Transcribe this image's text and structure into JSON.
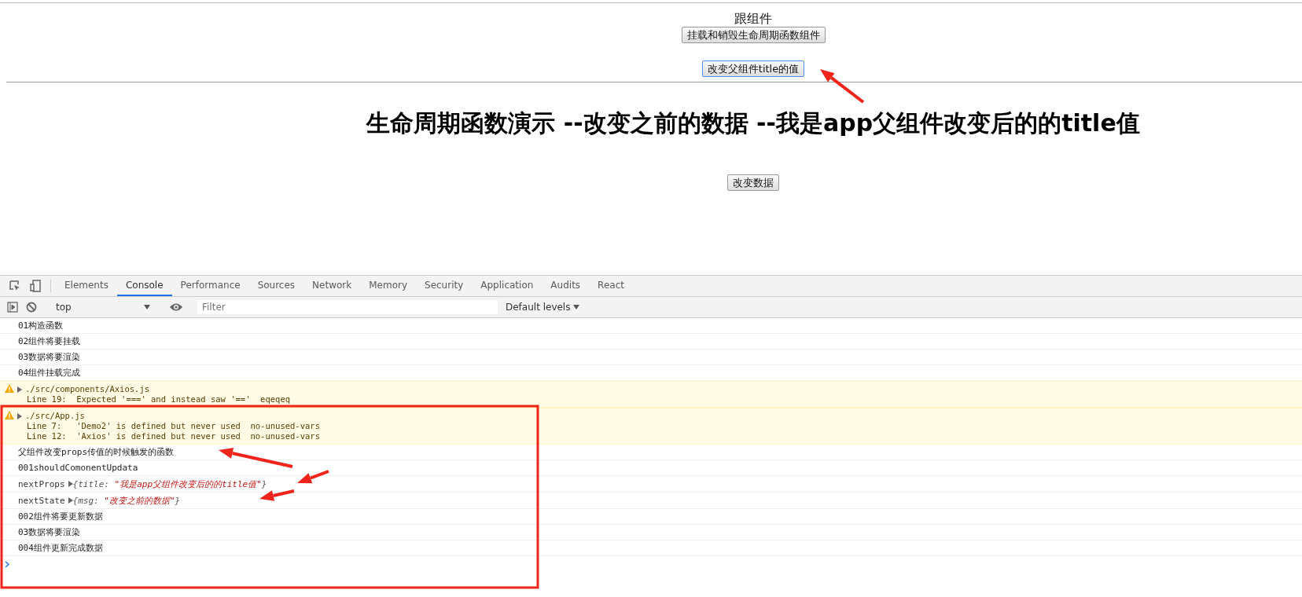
{
  "page": {
    "title": "跟组件",
    "mount_button": "挂载和销毁生命周期函数组件",
    "change_title_button": "改变父组件title的值",
    "heading": "生命周期函数演示 --改变之前的数据 --我是app父组件改变后的的title值",
    "change_data_button": "改变数据"
  },
  "devtools": {
    "tabs": [
      {
        "label": "Elements",
        "selected": false
      },
      {
        "label": "Console",
        "selected": true
      },
      {
        "label": "Performance",
        "selected": false
      },
      {
        "label": "Sources",
        "selected": false
      },
      {
        "label": "Network",
        "selected": false
      },
      {
        "label": "Memory",
        "selected": false
      },
      {
        "label": "Security",
        "selected": false
      },
      {
        "label": "Application",
        "selected": false
      },
      {
        "label": "Audits",
        "selected": false
      },
      {
        "label": "React",
        "selected": false
      }
    ],
    "context": "top",
    "filter_placeholder": "Filter",
    "levels": "Default levels"
  },
  "console": [
    {
      "kind": "log",
      "text": "01构造函数"
    },
    {
      "kind": "log",
      "text": "02组件将要挂载"
    },
    {
      "kind": "log",
      "text": "03数据将要渲染"
    },
    {
      "kind": "log",
      "text": "04组件挂载完成"
    },
    {
      "kind": "warning",
      "file": "./src/components/Axios.js",
      "lines": [
        "Line 19:  Expected '===' and instead saw '=='  eqeqeq"
      ]
    },
    {
      "kind": "warning",
      "file": "./src/App.js",
      "lines": [
        "Line 7:   'Demo2' is defined but never used  no-unused-vars",
        "Line 12:  'Axios' is defined but never used  no-unused-vars"
      ]
    },
    {
      "kind": "log",
      "text": "父组件改变props传值的时候触发的函数"
    },
    {
      "kind": "log",
      "text": "001shouldComonentUpdata"
    },
    {
      "kind": "object",
      "label": "nextProps",
      "prefix": "{title: ",
      "value": "\"我是app父组件改变后的的title值\"",
      "suffix": "}"
    },
    {
      "kind": "object",
      "label": "nextState",
      "prefix": "{msg: ",
      "value": "\"改变之前的数据\"",
      "suffix": "}"
    },
    {
      "kind": "log",
      "text": "002组件将要更新数据"
    },
    {
      "kind": "log",
      "text": "03数据将要渲染"
    },
    {
      "kind": "log",
      "text": "004组件更新完成数据"
    }
  ]
}
